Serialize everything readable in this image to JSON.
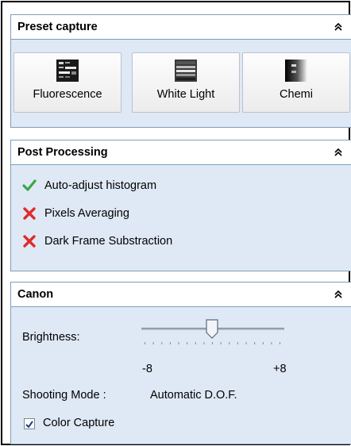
{
  "preset": {
    "title": "Preset capture",
    "buttons": [
      {
        "label": "Fluorescence",
        "icon": "fluorescence-gel-icon"
      },
      {
        "label": "White Light",
        "icon": "white-light-gel-icon"
      },
      {
        "label": "Chemi",
        "icon": "chemi-gel-icon"
      }
    ]
  },
  "post": {
    "title": "Post Processing",
    "items": [
      {
        "label": "Auto-adjust histogram",
        "enabled": true
      },
      {
        "label": "Pixels Averaging",
        "enabled": false
      },
      {
        "label": "Dark Frame Substraction",
        "enabled": false
      }
    ]
  },
  "canon": {
    "title": "Canon",
    "brightness_label": "Brightness:",
    "brightness_min": "-8",
    "brightness_max": "+8",
    "brightness_value": 0,
    "shooting_mode_label": "Shooting Mode :",
    "shooting_mode_value": "Automatic D.O.F.",
    "color_capture_label": "Color Capture",
    "color_capture_checked": true
  },
  "colors": {
    "panel_bg": "#dfe9f5",
    "border": "#7f9db9",
    "check_green": "#3aa64a",
    "cross_red": "#e02b2b"
  }
}
